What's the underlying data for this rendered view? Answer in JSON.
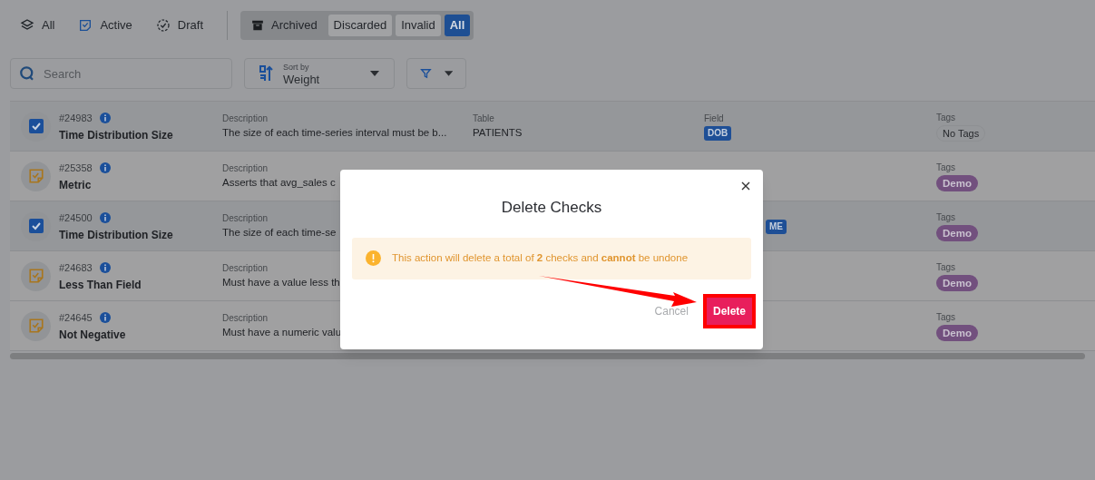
{
  "status_tabs": [
    {
      "label": "All",
      "kind": "layers"
    },
    {
      "label": "Active",
      "kind": "active"
    },
    {
      "label": "Draft",
      "kind": "draft"
    }
  ],
  "archived_group": {
    "label": "Archived",
    "filters": [
      {
        "label": "Discarded",
        "selected": false
      },
      {
        "label": "Invalid",
        "selected": false
      },
      {
        "label": "All",
        "selected": true
      }
    ]
  },
  "search": {
    "placeholder": "Search"
  },
  "sort": {
    "label": "Sort by",
    "value": "Weight"
  },
  "checks": [
    {
      "id": "#24983",
      "name": "Time Distribution Size",
      "selected": true,
      "description_label": "Description",
      "description": "The size of each time-series interval must be b...",
      "table_label": "Table",
      "table": "PATIENTS",
      "field_label": "Field",
      "field": "DOB",
      "tags_label": "Tags",
      "tags": [
        {
          "label": "No Tags",
          "kind": "empty"
        }
      ]
    },
    {
      "id": "#25358",
      "name": "Metric",
      "selected": false,
      "description_label": "Description",
      "description": "Asserts that avg_sales c",
      "tags_label": "Tags",
      "tags": [
        {
          "label": "Demo",
          "kind": "tag"
        }
      ]
    },
    {
      "id": "#24500",
      "name": "Time Distribution Size",
      "selected": true,
      "description_label": "Description",
      "description": "The size of each time-se",
      "field": "ME",
      "tags_label": "Tags",
      "tags": [
        {
          "label": "Demo",
          "kind": "tag"
        }
      ]
    },
    {
      "id": "#24683",
      "name": "Less Than Field",
      "selected": false,
      "description_label": "Description",
      "description": "Must have a value less th",
      "tags_label": "Tags",
      "tags": [
        {
          "label": "Demo",
          "kind": "tag"
        }
      ]
    },
    {
      "id": "#24645",
      "name": "Not Negative",
      "selected": false,
      "description_label": "Description",
      "description": "Must have a numeric valu",
      "tags_label": "Tags",
      "tags": [
        {
          "label": "Demo",
          "kind": "tag"
        }
      ]
    }
  ],
  "dialog": {
    "title": "Delete Checks",
    "message": "This action will delete a total of **2** checks and **cannot** be undone",
    "buttons": [
      {
        "label": "Cancel",
        "kind": "secondary"
      },
      {
        "label": "Delete",
        "kind": "danger"
      }
    ]
  }
}
